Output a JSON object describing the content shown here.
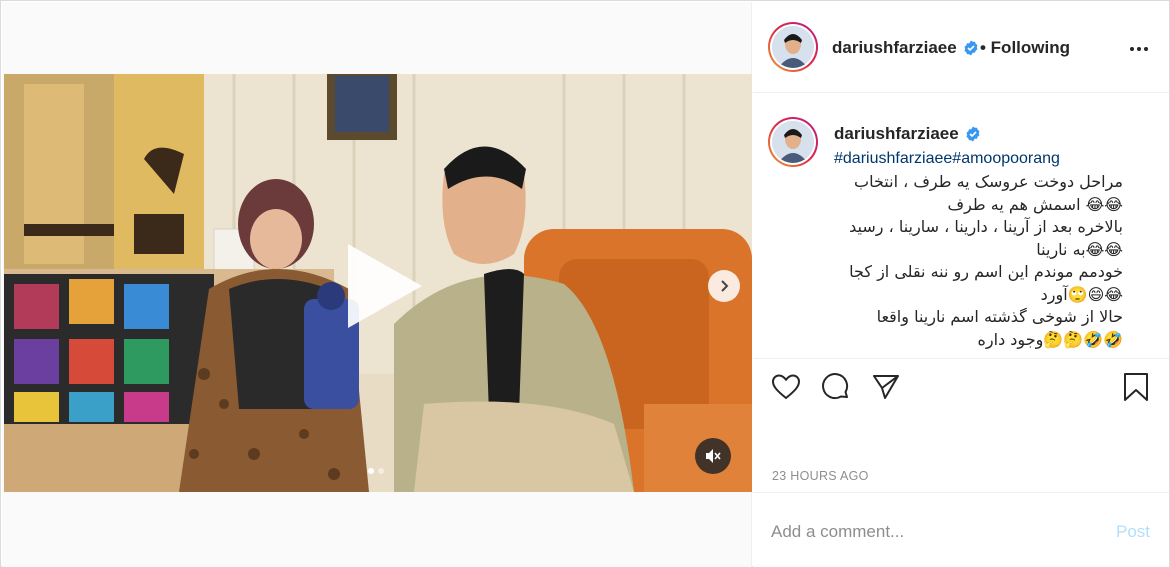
{
  "post": {
    "username": "dariushfarziaee",
    "follow_status": "• Following",
    "hashtags": "#dariushfarziaee#amoopoorang",
    "caption_lines": [
      "مراحل دوخت عروسک یه طرف ، انتخاب",
      "😂😂 اسمش هم یه طرف",
      "بالاخره بعد از آرینا ، دارینا ، سارینا ، رسید",
      "😂😂به نارینا",
      "خودمم موندم این اسم رو ننه نقلی از کجا",
      "😂😄🙄آورد",
      "حالا از شوخی گذشته اسم نارینا واقعا",
      "🤣🤣🤔🤔وجود داره"
    ],
    "timestamp": "23 HOURS AGO",
    "comment_placeholder": "Add a comment...",
    "post_label": "Post"
  },
  "media": {
    "type": "video",
    "carousel_count": 2,
    "carousel_active": 1
  },
  "icons": {
    "verified": "verified-badge-icon",
    "more": "more-options-icon",
    "like": "heart-icon",
    "comment": "comment-icon",
    "share": "share-icon",
    "save": "bookmark-icon",
    "play": "play-icon",
    "next": "chevron-right-icon",
    "mute": "muted-speaker-icon"
  },
  "colors": {
    "verified": "#3897f0",
    "link": "#00376b",
    "muted_text": "#8e8e8e",
    "post_disabled": "#b2dffc"
  }
}
